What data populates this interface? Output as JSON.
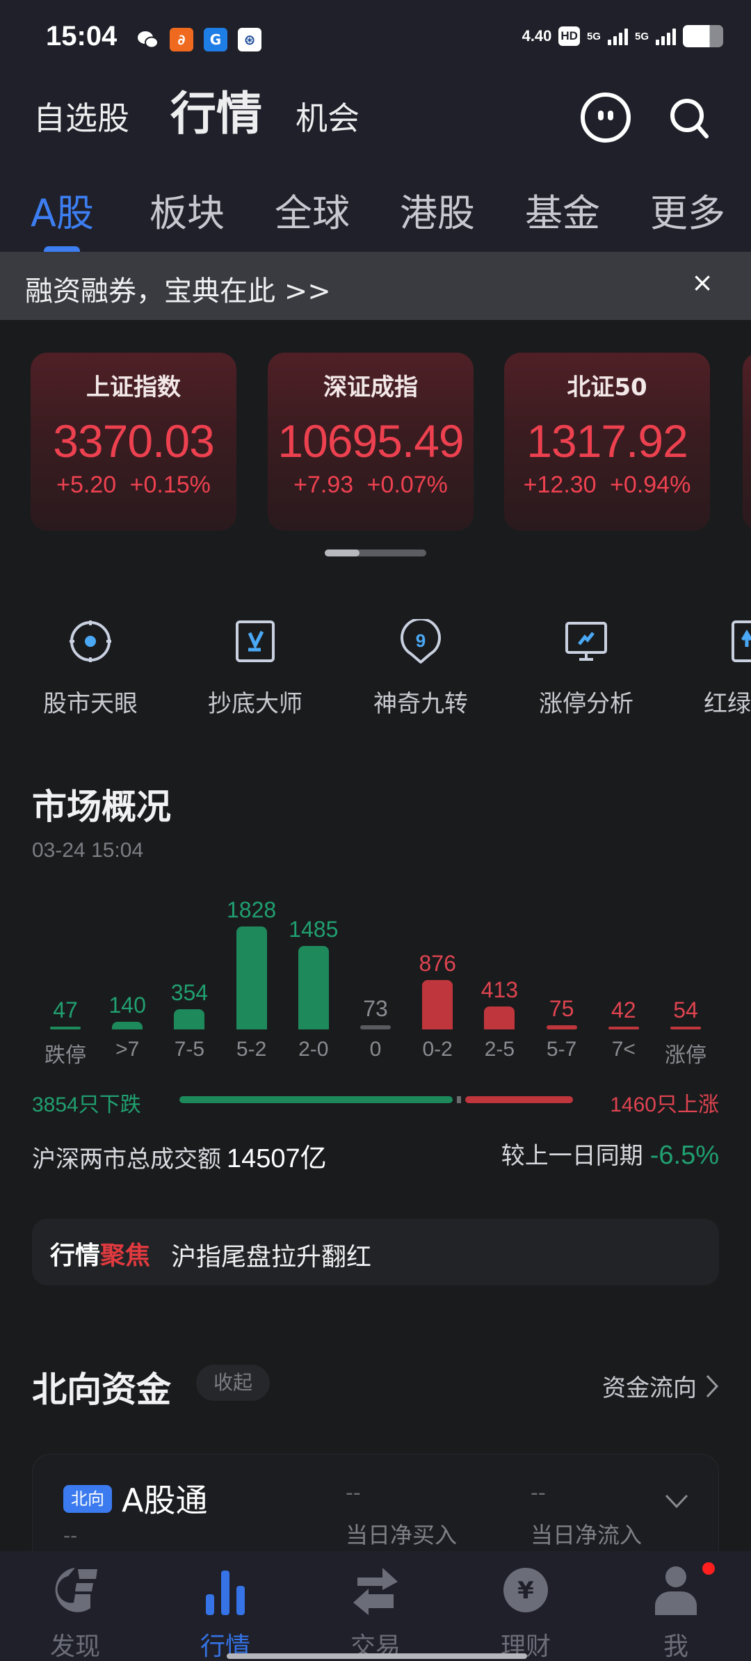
{
  "status_bar": {
    "time": "15:04",
    "net_speed": "4.40",
    "hd_label": "HD",
    "sim_labels": [
      "5G",
      "5G"
    ],
    "battery_level": 0.66,
    "notification_apps": [
      "wechat-icon",
      "alibaba-1688-icon",
      "securities-app-icon",
      "bank-app-icon"
    ]
  },
  "top_nav": {
    "items": [
      "自选股",
      "行情",
      "机会"
    ],
    "active_index": 1
  },
  "market_tabs": {
    "items": [
      "A股",
      "板块",
      "全球",
      "港股",
      "基金",
      "更多"
    ],
    "active_index": 0
  },
  "banner": {
    "text": "融资融券，宝典在此 >>",
    "close": "×"
  },
  "indices": [
    {
      "name": "上证指数",
      "value": "3370.03",
      "change": "+5.20",
      "pct": "+0.15%"
    },
    {
      "name": "深证成指",
      "value": "10695.49",
      "change": "+7.93",
      "pct": "+0.07%"
    },
    {
      "name": "北证50",
      "value": "1317.92",
      "change": "+12.30",
      "pct": "+0.94%"
    }
  ],
  "tools": [
    {
      "label": "股市天眼",
      "icon": "eye-target-icon"
    },
    {
      "label": "抄底大师",
      "icon": "bottom-fishing-icon"
    },
    {
      "label": "神奇九转",
      "icon": "nine-turn-icon"
    },
    {
      "label": "涨停分析",
      "icon": "limit-up-analysis-icon"
    },
    {
      "label": "红绿",
      "icon": "red-green-icon"
    }
  ],
  "market_overview": {
    "title": "市场概况",
    "datetime": "03-24 15:04",
    "down_summary": "3854只下跌",
    "up_summary": "1460只上涨",
    "flat_count": 73,
    "down_count": 3854,
    "up_count": 1460,
    "turnover_label": "沪深两市总成交额",
    "turnover_value": "14507亿",
    "compare_label": "较上一日同期",
    "compare_value": "-6.5%"
  },
  "chart_data": {
    "type": "bar",
    "title": "市场概况",
    "categories": [
      "跌停",
      ">7",
      "7-5",
      "5-2",
      "2-0",
      "0",
      "0-2",
      "2-5",
      "5-7",
      "7<",
      "涨停"
    ],
    "values": [
      47,
      140,
      354,
      1828,
      1485,
      73,
      876,
      413,
      75,
      42,
      54
    ],
    "colors": [
      "down",
      "down",
      "down",
      "down",
      "down",
      "flat",
      "up",
      "up",
      "up",
      "up",
      "up"
    ],
    "xlabel": "",
    "ylabel": "",
    "grid": false
  },
  "colors": {
    "up": "#c0363d",
    "up_text": "#df4450",
    "down": "#1e8a5c",
    "down_text": "#20a070",
    "flat": "#5a5b60",
    "flat_text": "#8b8c91",
    "accent": "#3d7ef2"
  },
  "focus": {
    "tag_white": "行情",
    "tag_red": "聚焦",
    "text": "沪指尾盘拉升翻红"
  },
  "northbound": {
    "title": "北向资金",
    "collapse_label": "收起",
    "flow_link": "资金流向",
    "card": {
      "badge": "北向",
      "name": "A股通",
      "sub_value": "--",
      "stats": [
        {
          "value": "--",
          "label": "当日净买入"
        },
        {
          "value": "--",
          "label": "当日净流入"
        }
      ]
    }
  },
  "bottom_nav": {
    "items": [
      {
        "label": "发现",
        "icon": "discover-icon"
      },
      {
        "label": "行情",
        "icon": "market-chart-icon"
      },
      {
        "label": "交易",
        "icon": "trade-arrows-icon"
      },
      {
        "label": "理财",
        "icon": "wealth-yen-icon"
      },
      {
        "label": "我",
        "icon": "profile-icon"
      }
    ],
    "active_index": 1,
    "has_notification_on": 4
  }
}
